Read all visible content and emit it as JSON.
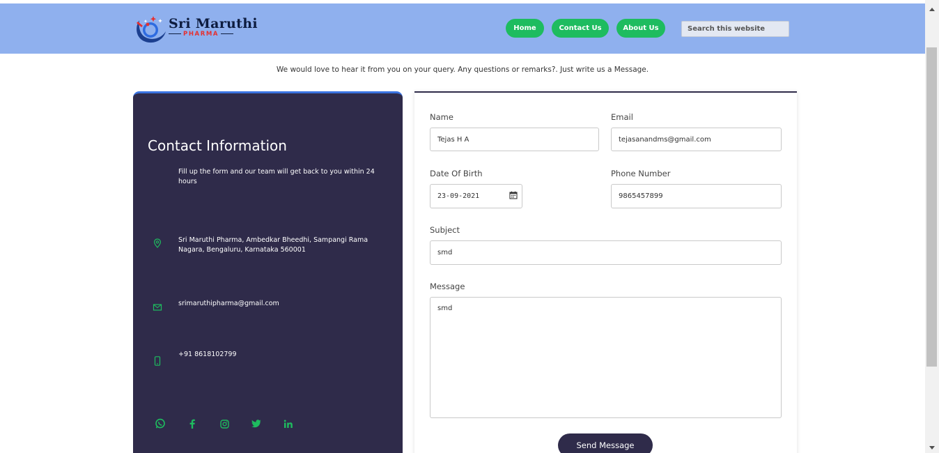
{
  "header": {
    "logo": {
      "title": "Sri Maruthi",
      "subtitle": "PHARMA"
    },
    "nav": [
      {
        "label": "Home"
      },
      {
        "label": "Contact Us"
      },
      {
        "label": "About Us"
      }
    ],
    "search_placeholder": "Search this website"
  },
  "tagline": "We would love to hear it from you on your query. Any questions or remarks?. Just write us a Message.",
  "contact_info": {
    "title": "Contact Information",
    "description": "Fill up the form and our team will get back to you within 24 hours",
    "address": "Sri Maruthi Pharma, Ambedkar Bheedhi, Sampangi Rama Nagara, Bengaluru, Karnataka 560001",
    "email": "srimaruthipharma@gmail.com",
    "phone": "+91 8618102799",
    "social_icons": [
      "whatsapp-icon",
      "facebook-icon",
      "instagram-icon",
      "twitter-icon",
      "linkedin-icon"
    ],
    "accent_color": "#1ebc5f",
    "card_color": "#2f2b4a"
  },
  "form": {
    "name": {
      "label": "Name",
      "value": "Tejas H A"
    },
    "email": {
      "label": "Email",
      "value": "tejasanandms@gmail.com"
    },
    "dob": {
      "label": "Date Of Birth",
      "value": "23-09-2021"
    },
    "phone": {
      "label": "Phone Number",
      "value": "9865457899"
    },
    "subject": {
      "label": "Subject",
      "value": "smd"
    },
    "message": {
      "label": "Message",
      "value": "smd"
    },
    "submit_label": "Send Message"
  }
}
